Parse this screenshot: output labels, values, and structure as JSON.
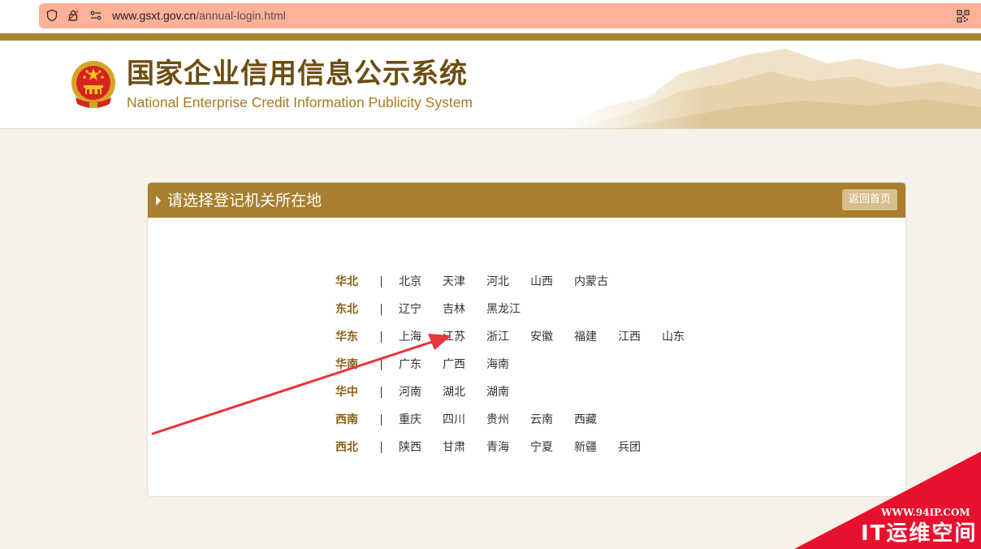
{
  "browser": {
    "url_host": "www.gsxt.gov.cn",
    "url_path": "/annual-login.html",
    "shield_icon": "shield-icon",
    "lock_icon": "lock-icon",
    "permissions_icon": "permissions-icon",
    "qr_icon": "qr-code-icon"
  },
  "header": {
    "title_cn": "国家企业信用信息公示系统",
    "title_en": "National Enterprise Credit Information Publicity System",
    "emblem_icon": "national-emblem-icon"
  },
  "panel": {
    "title": "请选择登记机关所在地",
    "back_label": "返回首页"
  },
  "regions": [
    {
      "name": "华北",
      "provinces": [
        "北京",
        "天津",
        "河北",
        "山西",
        "内蒙古"
      ]
    },
    {
      "name": "东北",
      "provinces": [
        "辽宁",
        "吉林",
        "黑龙江"
      ]
    },
    {
      "name": "华东",
      "provinces": [
        "上海",
        "江苏",
        "浙江",
        "安徽",
        "福建",
        "江西",
        "山东"
      ]
    },
    {
      "name": "华南",
      "provinces": [
        "广东",
        "广西",
        "海南"
      ]
    },
    {
      "name": "华中",
      "provinces": [
        "河南",
        "湖北",
        "湖南"
      ]
    },
    {
      "name": "西南",
      "provinces": [
        "重庆",
        "四川",
        "贵州",
        "云南",
        "西藏"
      ]
    },
    {
      "name": "西北",
      "provinces": [
        "陕西",
        "甘肃",
        "青海",
        "宁夏",
        "新疆",
        "兵团"
      ]
    }
  ],
  "watermark": {
    "url": "WWW.94IP.COM",
    "brand": "IT运维空间"
  },
  "colors": {
    "gold": "#a87f2f",
    "brand_brown": "#6e4d12",
    "annotation_red": "#e8343a",
    "watermark_red": "#e8112d"
  }
}
